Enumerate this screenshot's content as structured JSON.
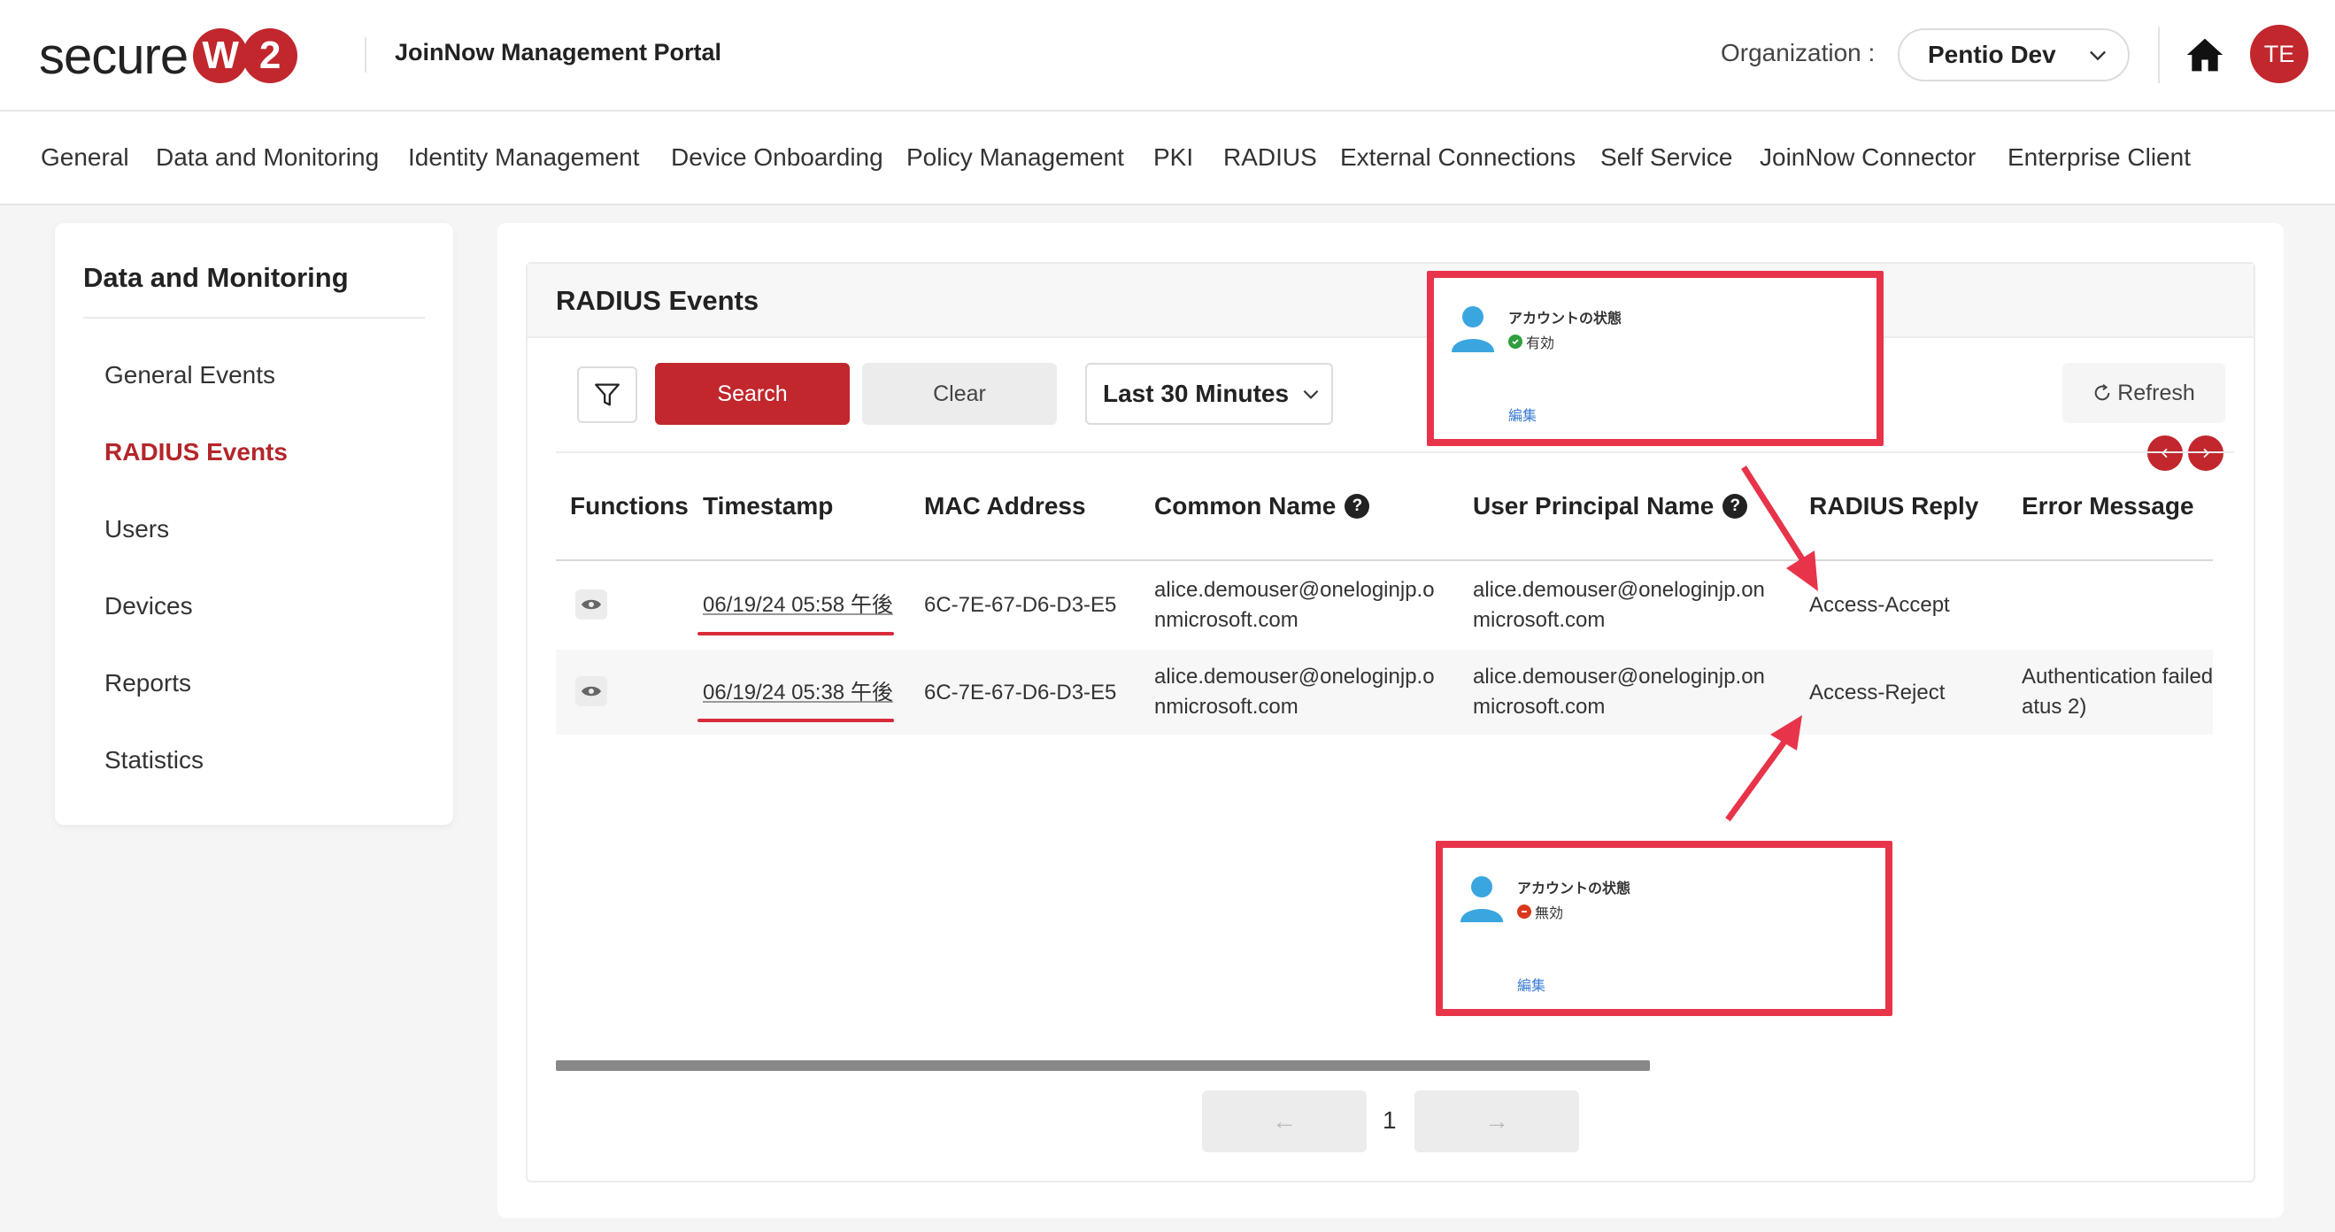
{
  "header": {
    "logo_word": "secure",
    "logo_badge": [
      "W",
      "2"
    ],
    "portal_title": "JoinNow Management Portal",
    "org_label": "Organization :",
    "org_value": "Pentio Dev",
    "avatar_initials": "TE",
    "icons": {
      "home": "home-icon",
      "chevron": "chevron-down-icon"
    }
  },
  "nav": {
    "items": [
      "General",
      "Data and Monitoring",
      "Identity Management",
      "Device Onboarding",
      "Policy Management",
      "PKI",
      "RADIUS",
      "External Connections",
      "Self Service",
      "JoinNow Connector",
      "Enterprise Client"
    ]
  },
  "sidebar": {
    "title": "Data and Monitoring",
    "items": [
      "General Events",
      "RADIUS Events",
      "Users",
      "Devices",
      "Reports",
      "Statistics"
    ],
    "active": "RADIUS Events"
  },
  "panel": {
    "title": "RADIUS Events",
    "search_label": "Search",
    "clear_label": "Clear",
    "range_value": "Last 30 Minutes",
    "refresh_label": "Refresh",
    "accent_color": "#c1272d"
  },
  "table": {
    "columns": [
      "Functions",
      "Timestamp",
      "MAC Address",
      "Common Name",
      "User Principal Name",
      "RADIUS Reply",
      "Error Message"
    ],
    "rows": [
      {
        "timestamp": "06/19/24 05:58 午後",
        "mac": "6C-7E-67-D6-D3-E5",
        "common_name_1": "alice.demouser@oneloginjp.o",
        "common_name_2": "nmicrosoft.com",
        "upn_1": "alice.demouser@oneloginjp.on",
        "upn_2": "microsoft.com",
        "reply": "Access-Accept",
        "error_1": "",
        "error_2": ""
      },
      {
        "timestamp": "06/19/24 05:38 午後",
        "mac": "6C-7E-67-D6-D3-E5",
        "common_name_1": "alice.demouser@oneloginjp.o",
        "common_name_2": "nmicrosoft.com",
        "upn_1": "alice.demouser@oneloginjp.on",
        "upn_2": "microsoft.com",
        "reply": "Access-Reject",
        "error_1": "Authentication failed",
        "error_2": "atus 2)"
      }
    ]
  },
  "pagination": {
    "prev": "←",
    "page": "1",
    "next": "→"
  },
  "annotations": [
    {
      "account_label": "アカウントの状態",
      "status": "有効",
      "status_color": "#2e9e3e",
      "edit": "編集"
    },
    {
      "account_label": "アカウントの状態",
      "status": "無効",
      "status_color": "#d9381e",
      "edit": "編集"
    }
  ]
}
